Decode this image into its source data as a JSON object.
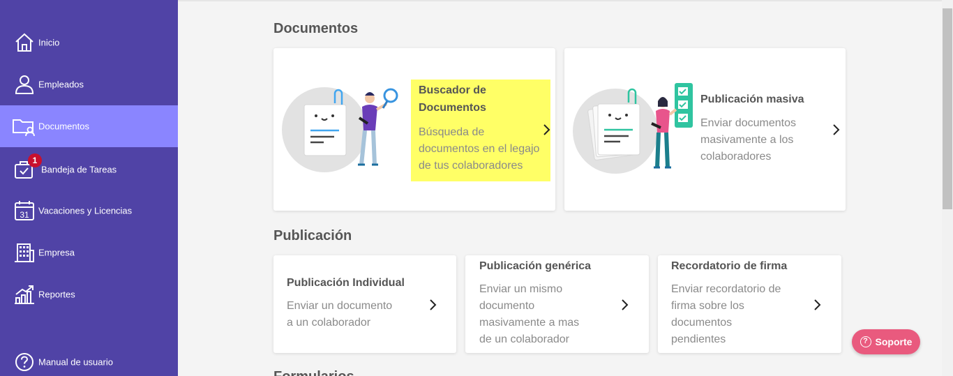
{
  "sidebar": {
    "items": [
      {
        "label": "Inicio",
        "icon": "home-icon"
      },
      {
        "label": "Empleados",
        "icon": "user-icon"
      },
      {
        "label": "Documentos",
        "icon": "folder-user-icon",
        "active": true
      },
      {
        "label": "Bandeja de Tareas",
        "icon": "task-bag-icon",
        "badge": "1"
      },
      {
        "label": "Vacaciones y Licencias",
        "icon": "calendar-icon",
        "calendar_day": "31"
      },
      {
        "label": "Empresa",
        "icon": "building-icon"
      },
      {
        "label": "Reportes",
        "icon": "chart-growth-icon"
      }
    ],
    "manual": {
      "label": "Manual de usuario",
      "icon": "help-circle-icon"
    }
  },
  "documentos": {
    "title": "Documentos",
    "cards": [
      {
        "title_line1": "Buscador de",
        "title_line2": "Documentos",
        "desc_lines": [
          "Búsqueda de",
          "documentos en el legajo",
          "de tus colaboradores"
        ],
        "highlight_color": "#ffff66"
      },
      {
        "title": "Publicación masiva",
        "desc_lines": [
          "Enviar documentos",
          "masivamente a los",
          "colaboradores"
        ]
      }
    ]
  },
  "publicacion": {
    "title": "Publicación",
    "cards": [
      {
        "title": "Publicación Individual",
        "desc_lines": [
          "Enviar un documento",
          "a un colaborador"
        ]
      },
      {
        "title": "Publicación genérica",
        "desc_lines": [
          "Enviar un mismo",
          "documento",
          "masivamente a mas",
          "de un colaborador"
        ]
      },
      {
        "title": "Recordatorio de firma",
        "desc_lines": [
          "Enviar recordatorio de",
          "firma sobre los",
          "documentos",
          "pendientes"
        ]
      }
    ]
  },
  "formularios": {
    "title": "Formularios"
  },
  "support": {
    "label": "Soporte",
    "icon": "question-circle-icon"
  },
  "colors": {
    "sidebar": "#5043a6",
    "active": "#8a85ff",
    "badge": "#c8102e",
    "support": "#e95a7e",
    "accent_teal": "#2fc4a0"
  }
}
